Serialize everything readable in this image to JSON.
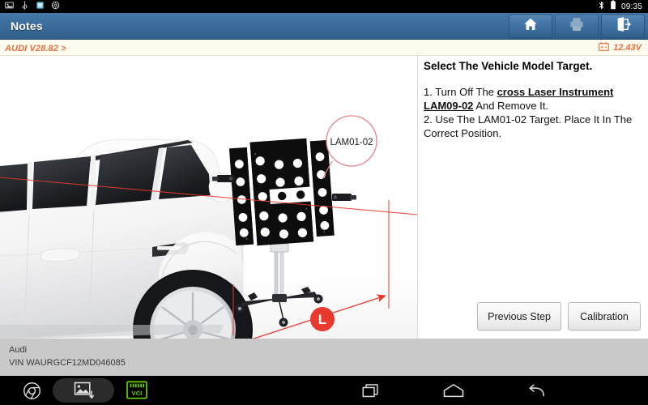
{
  "statusbar": {
    "icons": [
      "screenshot-icon",
      "usb-icon",
      "app-icon",
      "settings-icon"
    ],
    "bluetooth_icon": "bluetooth-icon",
    "battery_icon": "battery-icon",
    "time": "09:35"
  },
  "header": {
    "title": "Notes",
    "buttons": [
      {
        "name": "home-button",
        "icon": "home-icon",
        "enabled": true
      },
      {
        "name": "print-button",
        "icon": "printer-icon",
        "enabled": false
      },
      {
        "name": "exit-button",
        "icon": "exit-icon",
        "enabled": true
      }
    ]
  },
  "subbar": {
    "breadcrumb": "AUDI V28.82 >",
    "battery_icon": "car-battery-icon",
    "voltage": "12.43V"
  },
  "instructions": {
    "title": "Select The Vehicle Model Target.",
    "step1_prefix": "1. Turn Off The ",
    "step1_emphasis": "cross Laser Instrument LAM09-02",
    "step1_suffix": " And Remove It.",
    "step2": "2. Use The LAM01-02 Target. Place It In The Correct Position."
  },
  "buttons": {
    "previous_step": "Previous Step",
    "calibration": "Calibration"
  },
  "diagram": {
    "callout_label": "LAM01-02",
    "distance_label": "L",
    "callout_color": "#e8808a",
    "dimension_color": "#e8392e",
    "target_color": "#0d0d0d"
  },
  "footer": {
    "make": "Audi",
    "vin": "VIN WAURGCF12MD046085"
  },
  "navbar": {
    "items": [
      {
        "name": "chrome-button",
        "icon": "chrome-icon"
      },
      {
        "name": "screenshot-button",
        "icon": "screenshot-capture-icon"
      },
      {
        "name": "vci-button",
        "icon": "vci-icon",
        "label": "VCI"
      },
      {
        "name": "recents-button",
        "icon": "recents-icon"
      },
      {
        "name": "home-nav-button",
        "icon": "home-outline-icon"
      },
      {
        "name": "back-button",
        "icon": "back-arrow-icon"
      }
    ],
    "vci_label": "VCI",
    "vci_color": "#6dd400"
  }
}
